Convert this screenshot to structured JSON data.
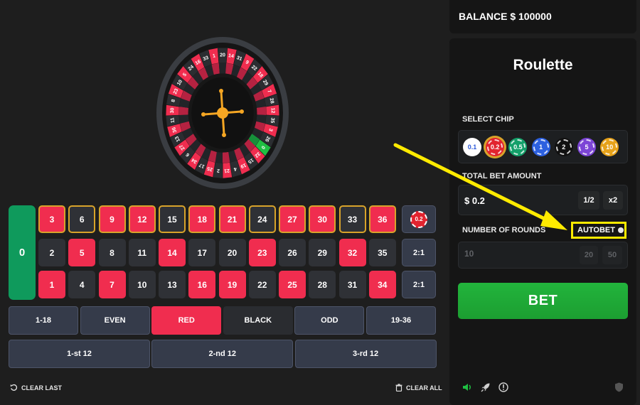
{
  "balance": {
    "text": "BALANCE $ 100000"
  },
  "panel": {
    "title": "Roulette",
    "select_chip_label": "SELECT CHIP",
    "chips": [
      {
        "label": "0.1",
        "color": "#ffffff",
        "text_color": "#2b58d9"
      },
      {
        "label": "0.2",
        "color": "#e2242f",
        "text_color": "#ffffff",
        "selected": true
      },
      {
        "label": "0.5",
        "color": "#14a06a",
        "text_color": "#ffffff"
      },
      {
        "label": "1",
        "color": "#2d61e0",
        "text_color": "#ffffff"
      },
      {
        "label": "2",
        "color": "#111111",
        "text_color": "#ffffff"
      },
      {
        "label": "5",
        "color": "#7c45d6",
        "text_color": "#ffffff"
      },
      {
        "label": "10",
        "color": "#e6a21a",
        "text_color": "#ffffff"
      }
    ],
    "total_bet_label": "TOTAL BET AMOUNT",
    "total_bet_value": "$ 0.2",
    "half_label": "1/2",
    "double_label": "x2",
    "rounds_label": "NUMBER OF ROUNDS",
    "autobet_label": "AUTOBET",
    "rounds_value": "10",
    "rounds_options": [
      "20",
      "50"
    ],
    "bet_label": "BET"
  },
  "table": {
    "zero": "0",
    "rows": [
      [
        {
          "n": "3",
          "c": "red",
          "hl": true
        },
        {
          "n": "6",
          "c": "black",
          "hl": true
        },
        {
          "n": "9",
          "c": "red",
          "hl": true
        },
        {
          "n": "12",
          "c": "red",
          "hl": true
        },
        {
          "n": "15",
          "c": "black",
          "hl": true
        },
        {
          "n": "18",
          "c": "red",
          "hl": true
        },
        {
          "n": "21",
          "c": "red",
          "hl": true
        },
        {
          "n": "24",
          "c": "black",
          "hl": true
        },
        {
          "n": "27",
          "c": "red",
          "hl": true
        },
        {
          "n": "30",
          "c": "red",
          "hl": true
        },
        {
          "n": "33",
          "c": "black",
          "hl": true
        },
        {
          "n": "36",
          "c": "red",
          "hl": true
        }
      ],
      [
        {
          "n": "2",
          "c": "black"
        },
        {
          "n": "5",
          "c": "red"
        },
        {
          "n": "8",
          "c": "black"
        },
        {
          "n": "11",
          "c": "black"
        },
        {
          "n": "14",
          "c": "red"
        },
        {
          "n": "17",
          "c": "black"
        },
        {
          "n": "20",
          "c": "black"
        },
        {
          "n": "23",
          "c": "red"
        },
        {
          "n": "26",
          "c": "black"
        },
        {
          "n": "29",
          "c": "black"
        },
        {
          "n": "32",
          "c": "red"
        },
        {
          "n": "35",
          "c": "black"
        }
      ],
      [
        {
          "n": "1",
          "c": "red"
        },
        {
          "n": "4",
          "c": "black"
        },
        {
          "n": "7",
          "c": "red"
        },
        {
          "n": "10",
          "c": "black"
        },
        {
          "n": "13",
          "c": "black"
        },
        {
          "n": "16",
          "c": "red"
        },
        {
          "n": "19",
          "c": "red"
        },
        {
          "n": "22",
          "c": "black"
        },
        {
          "n": "25",
          "c": "red"
        },
        {
          "n": "28",
          "c": "black"
        },
        {
          "n": "31",
          "c": "black"
        },
        {
          "n": "34",
          "c": "red"
        }
      ]
    ],
    "column_bets": [
      "0.2",
      "2:1",
      "2:1"
    ],
    "outside_row1": [
      {
        "label": "1-18",
        "style": "grey"
      },
      {
        "label": "EVEN",
        "style": "grey"
      },
      {
        "label": "RED",
        "style": "red"
      },
      {
        "label": "BLACK",
        "style": "black"
      },
      {
        "label": "ODD",
        "style": "grey"
      },
      {
        "label": "19-36",
        "style": "grey"
      }
    ],
    "dozens": [
      "1-st 12",
      "2-nd 12",
      "3-rd 12"
    ]
  },
  "controls": {
    "clear_last": "CLEAR LAST",
    "clear_all": "CLEAR ALL"
  },
  "wheel": {
    "numbers": [
      "0",
      "32",
      "15",
      "19",
      "4",
      "21",
      "2",
      "25",
      "17",
      "34",
      "6",
      "27",
      "13",
      "36",
      "11",
      "30",
      "8",
      "23",
      "10",
      "5",
      "24",
      "16",
      "33",
      "1",
      "20",
      "14",
      "31",
      "9",
      "22",
      "18",
      "29",
      "7",
      "28",
      "12",
      "35",
      "3",
      "26"
    ],
    "highlighted": "0"
  },
  "footer_icons": [
    "sound-icon",
    "rocket-icon",
    "info-icon",
    "shield-icon"
  ],
  "annotation": {
    "color": "#ffeb00"
  }
}
